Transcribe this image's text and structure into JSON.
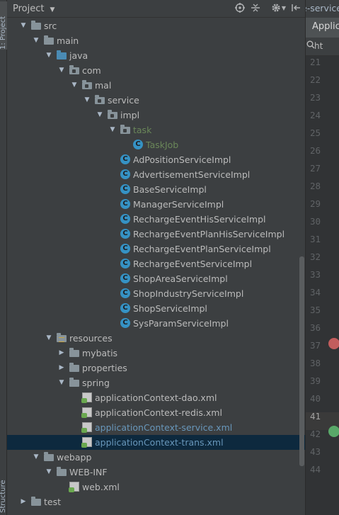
{
  "strip": {
    "project": "1: Project",
    "structure": "Structure"
  },
  "header": {
    "title": "Project",
    "dropdown": "▼"
  },
  "editor": {
    "top_tab": "e-service",
    "tab": "Applic",
    "search_text": "ht",
    "line_numbers": [
      "21",
      "22",
      "23",
      "24",
      "25",
      "26",
      "27",
      "28",
      "29",
      "30",
      "31",
      "32",
      "33",
      "34",
      "35",
      "36",
      "37",
      "38",
      "39",
      "40",
      "41",
      "42",
      "43",
      "44"
    ],
    "current_line": "41"
  },
  "tree": [
    {
      "label": "src",
      "type": "folder",
      "expanded": true
    },
    {
      "label": "main",
      "type": "folder",
      "expanded": true
    },
    {
      "label": "java",
      "type": "folder-blue",
      "expanded": true
    },
    {
      "label": "com",
      "type": "package",
      "expanded": true
    },
    {
      "label": "mal",
      "type": "package",
      "expanded": true
    },
    {
      "label": "service",
      "type": "package",
      "expanded": true
    },
    {
      "label": "impl",
      "type": "package",
      "expanded": true
    },
    {
      "label": "task",
      "type": "package",
      "expanded": true
    },
    {
      "label": "TaskJob",
      "type": "class"
    },
    {
      "label": "AdPositionServiceImpl",
      "type": "class"
    },
    {
      "label": "AdvertisementServiceImpl",
      "type": "class"
    },
    {
      "label": "BaseServiceImpl",
      "type": "class"
    },
    {
      "label": "ManagerServiceImpl",
      "type": "class"
    },
    {
      "label": "RechargeEventHisServiceImpl",
      "type": "class"
    },
    {
      "label": "RechargeEventPlanHisServiceImpl",
      "type": "class"
    },
    {
      "label": "RechargeEventPlanServiceImpl",
      "type": "class"
    },
    {
      "label": "RechargeEventServiceImpl",
      "type": "class"
    },
    {
      "label": "ShopAreaServiceImpl",
      "type": "class"
    },
    {
      "label": "ShopIndustryServiceImpl",
      "type": "class"
    },
    {
      "label": "ShopServiceImpl",
      "type": "class"
    },
    {
      "label": "SysParamServiceImpl",
      "type": "class"
    },
    {
      "label": "resources",
      "type": "folder-res",
      "expanded": true
    },
    {
      "label": "mybatis",
      "type": "folder",
      "expanded": false
    },
    {
      "label": "properties",
      "type": "folder",
      "expanded": false
    },
    {
      "label": "spring",
      "type": "folder",
      "expanded": true
    },
    {
      "label": "applicationContext-dao.xml",
      "type": "xml"
    },
    {
      "label": "applicationContext-redis.xml",
      "type": "xml"
    },
    {
      "label": "applicationContext-service.xml",
      "type": "xml"
    },
    {
      "label": "applicationContext-trans.xml",
      "type": "xml",
      "selected": true
    },
    {
      "label": "webapp",
      "type": "folder",
      "expanded": true
    },
    {
      "label": "WEB-INF",
      "type": "folder",
      "expanded": true
    },
    {
      "label": "web.xml",
      "type": "xml"
    },
    {
      "label": "test",
      "type": "folder",
      "expanded": false
    }
  ]
}
